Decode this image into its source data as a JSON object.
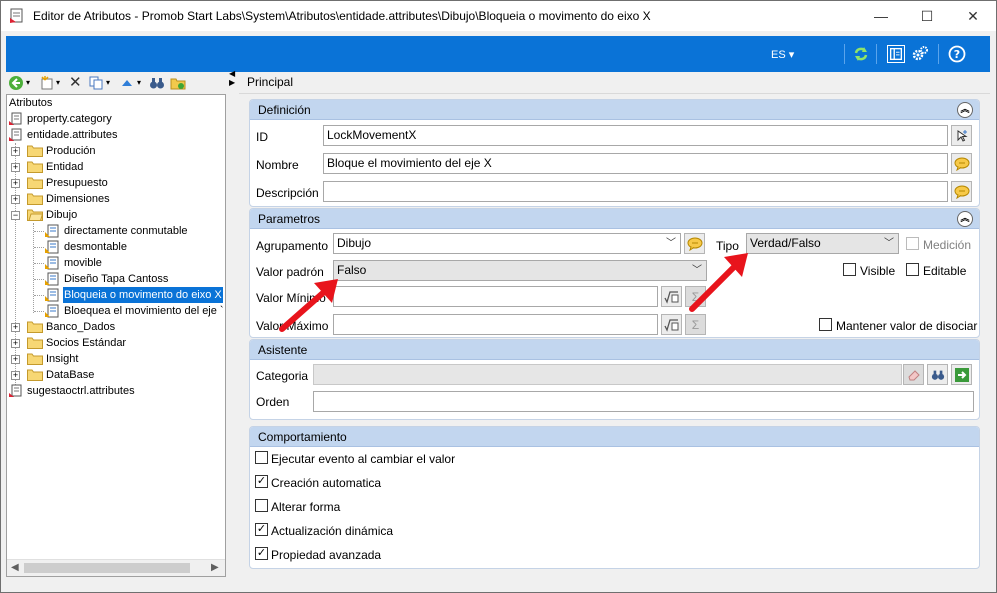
{
  "window": {
    "title": "Editor de Atributos - Promob Start Labs\\System\\Atributos\\entidade.attributes\\Dibujo\\Bloqueia o movimento do eixo X",
    "minimize": "—",
    "maximize": "☐",
    "close": "✕"
  },
  "topbar": {
    "language": "ES ▾",
    "refresh_icon": "refresh-icon",
    "layout_icon": "layout-icon",
    "settings_icon": "gear-icon",
    "help_icon": "help-icon"
  },
  "tree": {
    "items": [
      {
        "label": "Atributos"
      },
      {
        "label": "property.category"
      },
      {
        "label": "entidade.attributes"
      },
      {
        "label": "Produción"
      },
      {
        "label": "Entidad"
      },
      {
        "label": "Presupuesto"
      },
      {
        "label": "Dimensiones"
      },
      {
        "label": "Dibujo"
      },
      {
        "label": "directamente conmutable"
      },
      {
        "label": "desmontable"
      },
      {
        "label": "movible"
      },
      {
        "label": "Diseño Tapa Cantoss"
      },
      {
        "label": "Bloqueia o movimento do eixo X"
      },
      {
        "label": "Bloequea el movimiento del eje `"
      },
      {
        "label": "Banco_Dados"
      },
      {
        "label": "Socios Estándar"
      },
      {
        "label": "Insight"
      },
      {
        "label": "DataBase"
      },
      {
        "label": "sugestaoctrl.attributes"
      }
    ],
    "selected": "Bloqueia o movimento do eixo X"
  },
  "main": {
    "tab": "Principal",
    "definicion": {
      "header": "Definición",
      "id_label": "ID",
      "id_value": "LockMovementX",
      "nombre_label": "Nombre",
      "nombre_value": "Bloque el movimiento del eje X",
      "descripcion_label": "Descripción",
      "descripcion_value": ""
    },
    "parametros": {
      "header": "Parametros",
      "agrupamento_label": "Agrupamento",
      "agrupamento_value": "Dibujo",
      "tipo_label": "Tipo",
      "tipo_value": "Verdad/Falso",
      "medicion_label": "Medición",
      "valor_padron_label": "Valor padrón",
      "valor_padron_value": "Falso",
      "visible_label": "Visible",
      "editable_label": "Editable",
      "valor_minimo_label": "Valor Mínimo",
      "valor_maximo_label": "Valor Máximo",
      "mantener_label": "Mantener valor de disociar"
    },
    "asistente": {
      "header": "Asistente",
      "categoria_label": "Categoria",
      "orden_label": "Orden"
    },
    "comportamiento": {
      "header": "Comportamiento",
      "options": [
        {
          "label": "Ejecutar evento al cambiar el valor",
          "checked": false
        },
        {
          "label": "Creación automatica",
          "checked": true
        },
        {
          "label": "Alterar forma",
          "checked": false
        },
        {
          "label": "Actualización dinámica",
          "checked": true
        },
        {
          "label": "Propiedad avanzada",
          "checked": true
        }
      ]
    }
  },
  "colors": {
    "accent": "#0a73d7",
    "group_header": "#c2d6ef",
    "annotation_arrow": "#e8141c"
  }
}
